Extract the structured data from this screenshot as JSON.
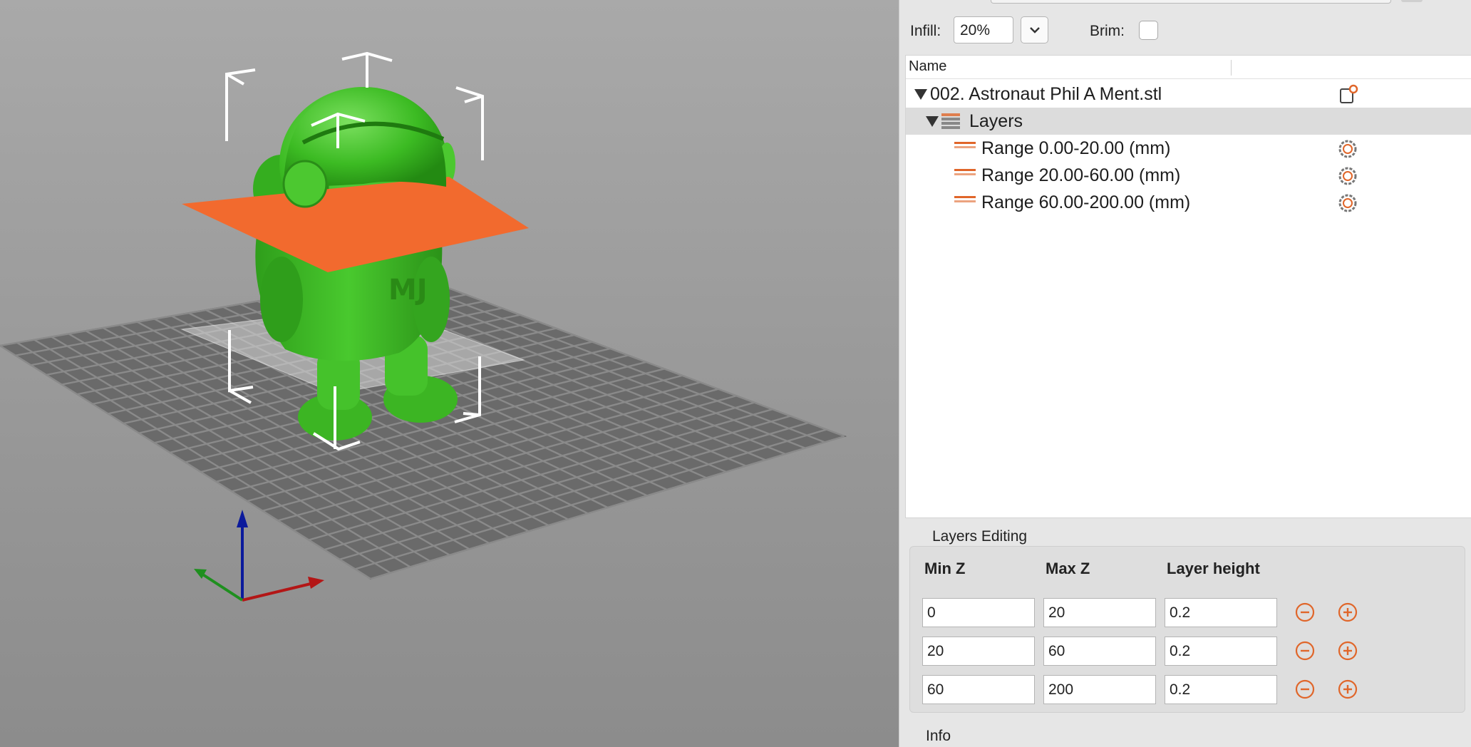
{
  "colors": {
    "model_green": "#3fbf27",
    "cut_plane_orange": "#f26a2e",
    "viewport_bg": "#9f9f9f",
    "accent_orange": "#e0662a"
  },
  "settings": {
    "infill_label": "Infill:",
    "infill_value": "20%",
    "brim_label": "Brim:",
    "brim_checked": false
  },
  "object_list": {
    "column_name": "Name",
    "object": {
      "name": "002. Astronaut Phil A Ment.stl",
      "icon": "object-settings-icon"
    },
    "layers_node": {
      "label": "Layers",
      "icon": "layers-icon"
    },
    "ranges": [
      {
        "label": "Range 0.00-20.00 (mm)",
        "icon": "gear-icon"
      },
      {
        "label": "Range 20.00-60.00 (mm)",
        "icon": "gear-icon"
      },
      {
        "label": "Range 60.00-200.00 (mm)",
        "icon": "gear-icon"
      }
    ]
  },
  "layers_editing": {
    "title": "Layers Editing",
    "headers": {
      "min_z": "Min Z",
      "max_z": "Max Z",
      "layer_height": "Layer height"
    },
    "rows": [
      {
        "min_z": "0",
        "max_z": "20",
        "layer_height": "0.2"
      },
      {
        "min_z": "20",
        "max_z": "60",
        "layer_height": "0.2"
      },
      {
        "min_z": "60",
        "max_z": "200",
        "layer_height": "0.2"
      }
    ]
  },
  "info": {
    "title": "Info"
  }
}
